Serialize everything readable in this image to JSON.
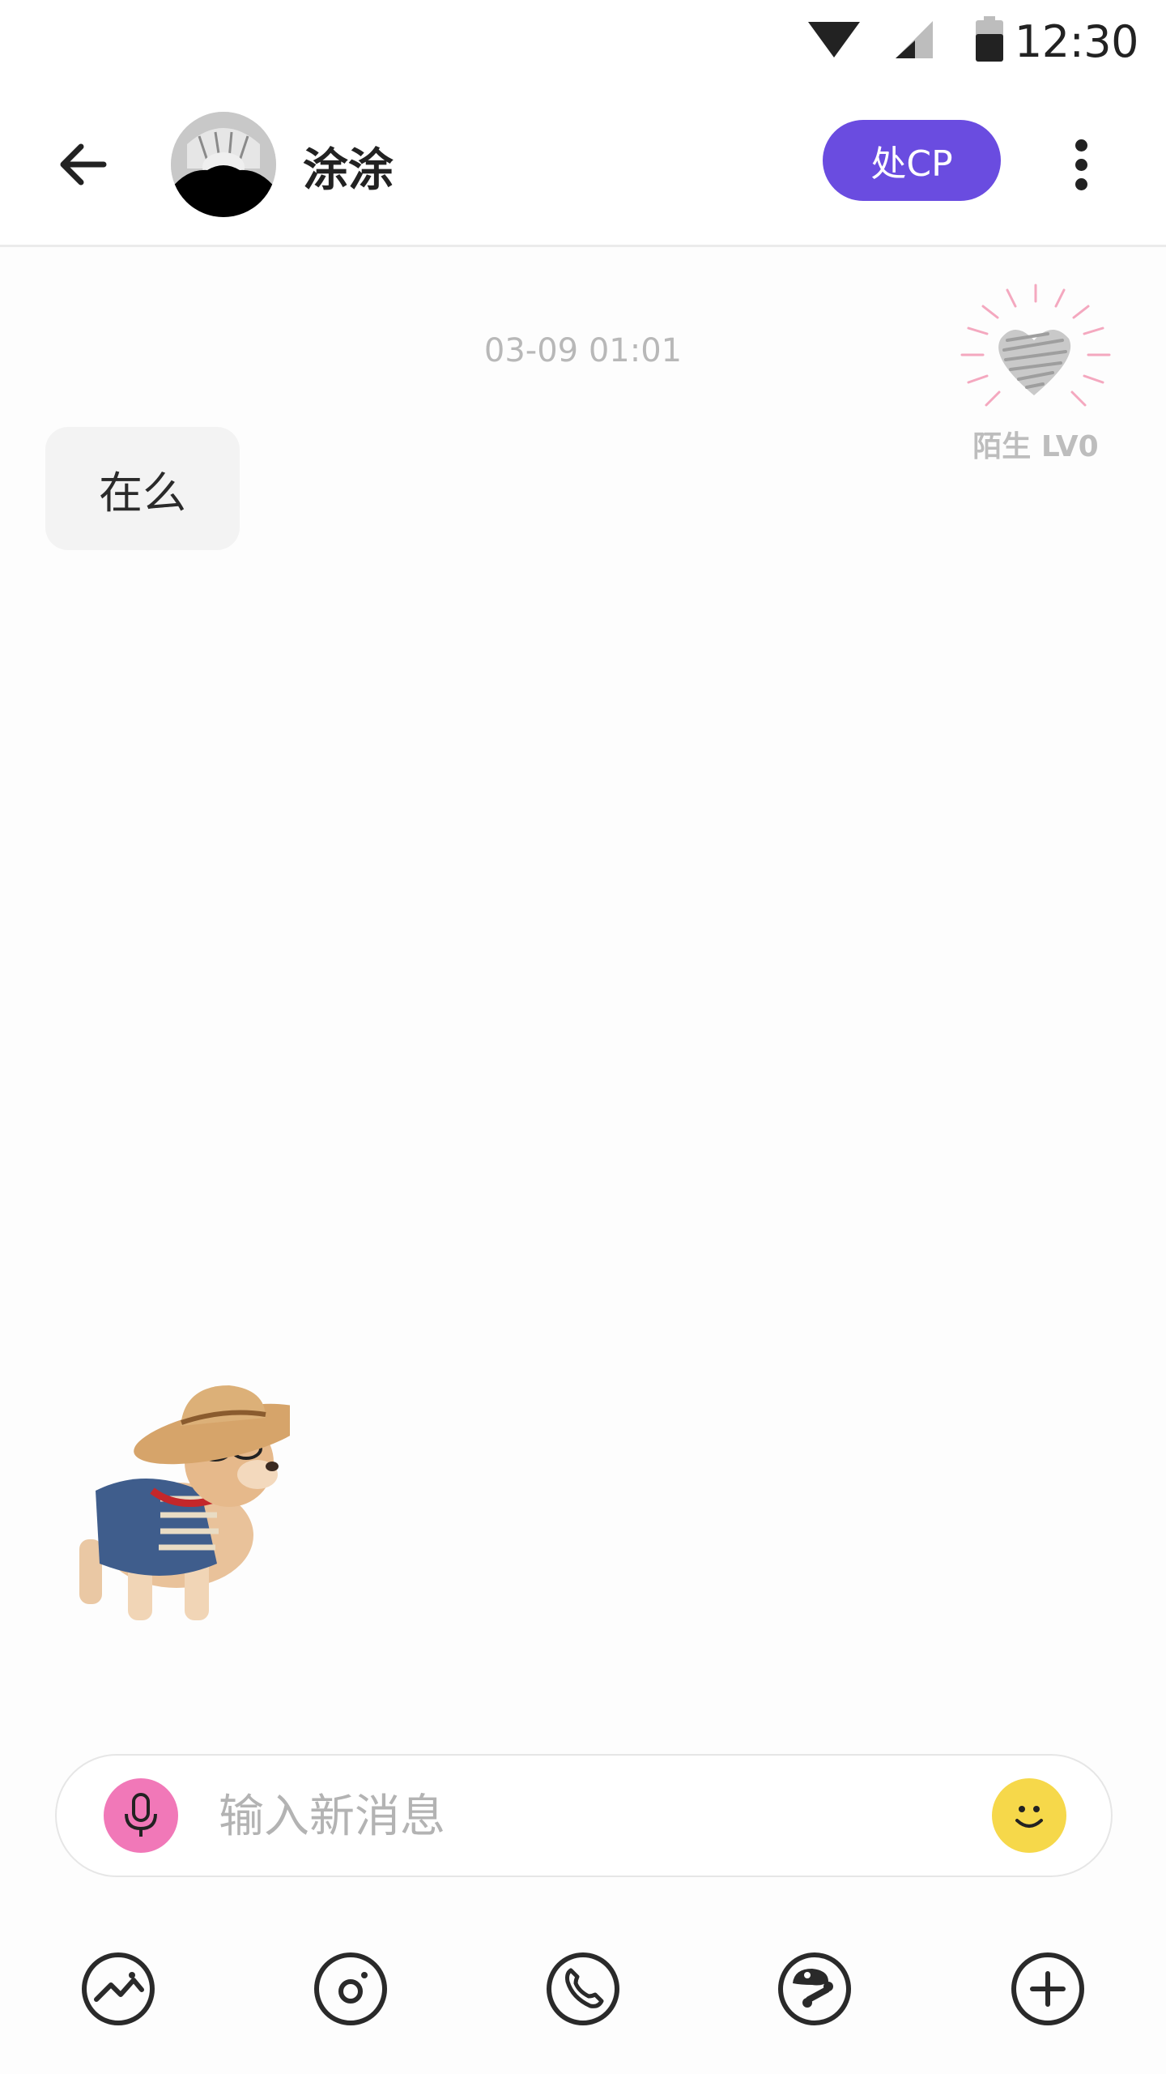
{
  "status_bar": {
    "time": "12:30"
  },
  "header": {
    "contact_name": "涂涂",
    "cp_button_label": "处CP"
  },
  "level_badge": {
    "label": "陌生 LV0"
  },
  "conversation": {
    "timestamp": "03-09 01:01",
    "messages": [
      {
        "text": "在么"
      }
    ]
  },
  "input": {
    "placeholder": "输入新消息"
  },
  "icons": {
    "back": "arrow-left-icon",
    "more": "more-vertical-icon",
    "mic": "microphone-icon",
    "emoji": "smiley-icon",
    "toolbar": [
      "image-icon",
      "camera-icon",
      "phone-icon",
      "game-icon",
      "plus-icon"
    ]
  },
  "colors": {
    "accent": "#6a4ce0",
    "mic": "#f178b8",
    "emoji": "#f6d84a",
    "badge_rays": "#f4a8bf"
  }
}
